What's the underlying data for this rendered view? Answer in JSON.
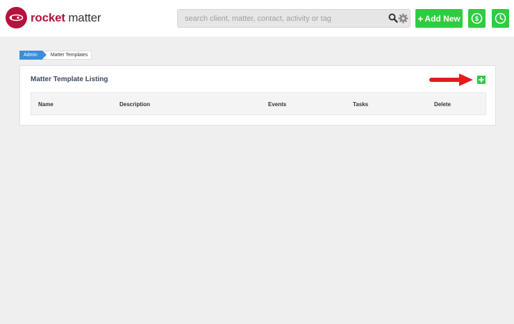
{
  "header": {
    "logo_text_bold": "rocket",
    "logo_text_rest": " matter",
    "search_placeholder": "search client, matter, contact, activity or tag",
    "add_new_label": "Add New",
    "billing_icon": "dollar-circle-icon",
    "timer_icon": "clock-icon"
  },
  "breadcrumb": {
    "items": [
      {
        "label": "Admin"
      },
      {
        "label": "Matter Templates"
      }
    ]
  },
  "panel": {
    "title": "Matter Template Listing",
    "add_icon": "plus-icon",
    "annotation_icon": "red-arrow-icon",
    "columns": [
      "Name",
      "Description",
      "Events",
      "Tasks",
      "Delete"
    ]
  },
  "colors": {
    "brand": "#b5123f",
    "accent_green": "#2ecc40",
    "crumb_blue": "#3a8fd8",
    "background": "#efefef"
  }
}
